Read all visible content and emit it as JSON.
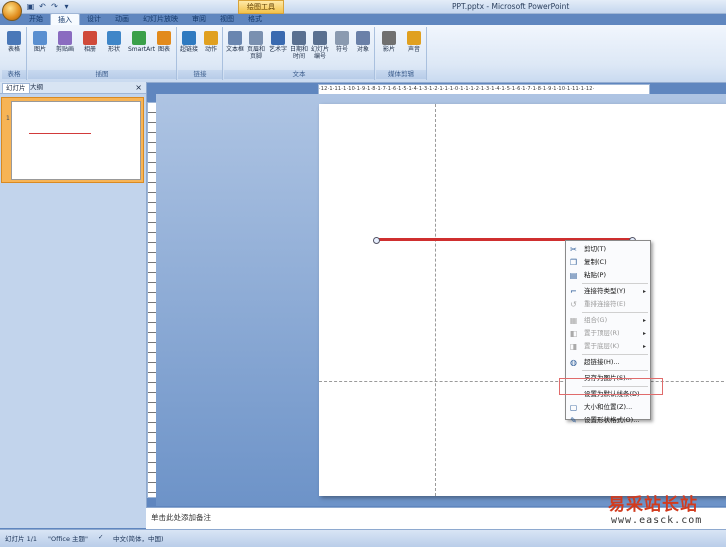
{
  "window": {
    "title": "PPT.pptx - Microsoft PowerPoint",
    "context_title": "绘图工具"
  },
  "qat": [
    "save-icon",
    "undo-icon",
    "redo-icon",
    "customize-icon"
  ],
  "tabs": [
    "开始",
    "插入",
    "设计",
    "动画",
    "幻灯片放映",
    "审阅",
    "视图",
    "格式"
  ],
  "active_tab": "插入",
  "ribbon": {
    "groups": [
      {
        "label": "表格",
        "buttons": [
          {
            "label": "表格",
            "icon": "table-icon",
            "color": "#4a78b8"
          }
        ]
      },
      {
        "label": "插图",
        "buttons": [
          {
            "label": "图片",
            "icon": "picture-icon",
            "color": "#5a8fd0"
          },
          {
            "label": "剪贴画",
            "icon": "clipart-icon",
            "color": "#8a6bc0"
          },
          {
            "label": "相册",
            "icon": "album-icon",
            "color": "#d04a3a"
          },
          {
            "label": "形状",
            "icon": "shapes-icon",
            "color": "#3f86c8"
          },
          {
            "label": "SmartArt",
            "icon": "smartart-icon",
            "color": "#3aa04a"
          },
          {
            "label": "图表",
            "icon": "chart-icon",
            "color": "#e28a1c"
          }
        ]
      },
      {
        "label": "链接",
        "buttons": [
          {
            "label": "超链接",
            "icon": "hyperlink-icon",
            "color": "#2f7ac0"
          },
          {
            "label": "动作",
            "icon": "action-icon",
            "color": "#e0a020"
          }
        ]
      },
      {
        "label": "文本",
        "buttons": [
          {
            "label": "文本框",
            "icon": "textbox-icon",
            "color": "#6a86b0"
          },
          {
            "label": "页眉和页脚",
            "icon": "header-footer-icon",
            "color": "#7a90b0"
          },
          {
            "label": "艺术字",
            "icon": "wordart-icon",
            "color": "#3a6ab0"
          },
          {
            "label": "日期和时间",
            "icon": "datetime-icon",
            "color": "#5a7090"
          },
          {
            "label": "幻灯片编号",
            "icon": "slide-number-icon",
            "color": "#5a7090"
          },
          {
            "label": "符号",
            "icon": "symbol-icon",
            "color": "#8a9ab0"
          },
          {
            "label": "对象",
            "icon": "object-icon",
            "color": "#6a80a8"
          }
        ]
      },
      {
        "label": "媒体剪辑",
        "buttons": [
          {
            "label": "影片",
            "icon": "movie-icon",
            "color": "#707070"
          },
          {
            "label": "声音",
            "icon": "sound-icon",
            "color": "#e0a020"
          }
        ]
      }
    ]
  },
  "slide_pane": {
    "tabs": [
      "幻灯片",
      "大纲"
    ],
    "close": "×",
    "slide_number": "1"
  },
  "ruler_text": "·12·1·11·1·10·1·9·1·8·1·7·1·6·1·5·1·4·1·3·1·2·1·1·1·0·1·1·1·2·1·3·1·4·1·5·1·6·1·7·1·8·1·9·1·10·1·11·1·12·",
  "context_menu": {
    "items": [
      {
        "label": "剪切(T)",
        "icon": "cut-icon",
        "disabled": false,
        "submenu": false
      },
      {
        "label": "复制(C)",
        "icon": "copy-icon",
        "disabled": false,
        "submenu": false
      },
      {
        "label": "粘贴(P)",
        "icon": "paste-icon",
        "disabled": false,
        "submenu": false
      },
      {
        "separator": true
      },
      {
        "label": "连接符类型(Y)",
        "icon": "connector-icon",
        "disabled": false,
        "submenu": true
      },
      {
        "label": "重排连接符(E)",
        "icon": "reroute-icon",
        "disabled": true,
        "submenu": false
      },
      {
        "separator": true
      },
      {
        "label": "组合(G)",
        "icon": "group-icon",
        "disabled": true,
        "submenu": true
      },
      {
        "label": "置于顶层(R)",
        "icon": "bring-front-icon",
        "disabled": true,
        "submenu": true
      },
      {
        "label": "置于底层(K)",
        "icon": "send-back-icon",
        "disabled": true,
        "submenu": true
      },
      {
        "separator": true
      },
      {
        "label": "超链接(H)...",
        "icon": "hyperlink-icon",
        "disabled": false,
        "submenu": false
      },
      {
        "separator": true
      },
      {
        "label": "另存为图片(S)...",
        "icon": "",
        "disabled": false,
        "submenu": false
      },
      {
        "separator": true
      },
      {
        "label": "设置为默认线条(D)",
        "icon": "",
        "disabled": false,
        "submenu": false
      },
      {
        "label": "大小和位置(Z)...",
        "icon": "size-icon",
        "disabled": false,
        "submenu": false
      },
      {
        "label": "设置形状格式(O)...",
        "icon": "format-shape-icon",
        "disabled": false,
        "submenu": false
      }
    ]
  },
  "notes_placeholder": "单击此处添加备注",
  "status": {
    "slide": "幻灯片 1/1",
    "theme": "\"Office 主题\"",
    "language": "中文(简体，中国)"
  },
  "watermark": {
    "title": "易采站长站",
    "url": "www.easck.com"
  },
  "colors": {
    "shape_line": "#cf2f2f",
    "accent_highlight": "#e06b6b"
  }
}
